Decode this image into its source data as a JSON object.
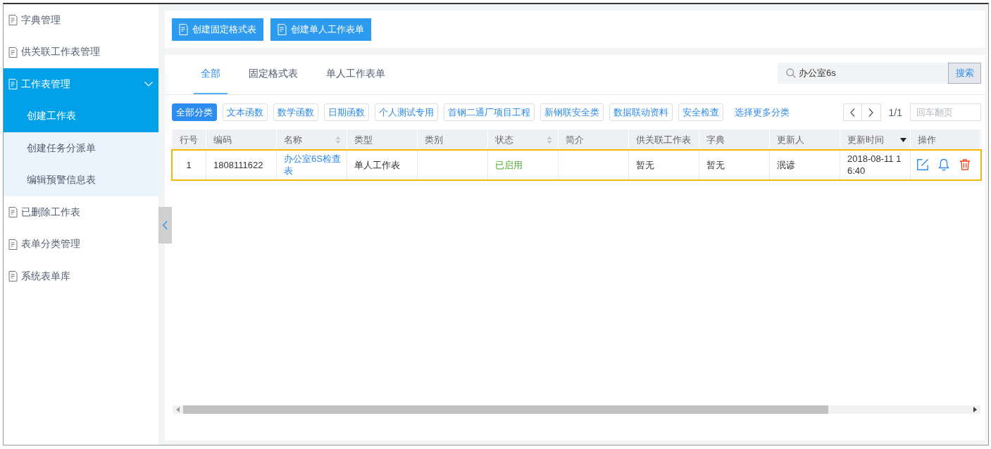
{
  "sidebar": {
    "items": [
      {
        "label": "字典管理",
        "selected": false
      },
      {
        "label": "供关联工作表管理",
        "selected": false
      },
      {
        "label": "工作表管理",
        "selected": true,
        "expanded": true,
        "children": [
          {
            "label": "创建工作表",
            "selected": true
          },
          {
            "label": "创建任务分派单",
            "selected": false
          },
          {
            "label": "编辑预警信息表",
            "selected": false
          }
        ]
      },
      {
        "label": "已删除工作表",
        "selected": false
      },
      {
        "label": "表单分类管理",
        "selected": false
      },
      {
        "label": "系统表单库",
        "selected": false
      }
    ]
  },
  "toolbar": {
    "buttons": [
      "创建固定格式表",
      "创建单人工作表单"
    ]
  },
  "tabs": [
    {
      "label": "全部",
      "selected": true
    },
    {
      "label": "固定格式表",
      "selected": false
    },
    {
      "label": "单人工作表单",
      "selected": false
    }
  ],
  "search": {
    "value": "办公室6s",
    "button": "搜索"
  },
  "categories": {
    "chips": [
      {
        "label": "全部分类",
        "selected": true
      },
      {
        "label": "文本函数",
        "selected": false
      },
      {
        "label": "数学函数",
        "selected": false
      },
      {
        "label": "日期函数",
        "selected": false
      },
      {
        "label": "个人测试专用",
        "selected": false
      },
      {
        "label": "首钢二通厂项目工程",
        "selected": false
      },
      {
        "label": "新钢联安全类",
        "selected": false
      },
      {
        "label": "数据联动资料",
        "selected": false
      },
      {
        "label": "安全检查",
        "selected": false
      }
    ],
    "more_link": "选择更多分类"
  },
  "pagination": {
    "page": "1/1",
    "jump_placeholder": "回车翻页"
  },
  "table": {
    "columns": [
      {
        "label": "行号",
        "sort_arrows": false,
        "sorted_descending": false
      },
      {
        "label": "编码",
        "sort_arrows": false,
        "sorted_descending": false
      },
      {
        "label": "名称",
        "sort_arrows": true,
        "sorted_descending": false
      },
      {
        "label": "类型",
        "sort_arrows": false,
        "sorted_descending": false
      },
      {
        "label": "类别",
        "sort_arrows": false,
        "sorted_descending": false
      },
      {
        "label": "状态",
        "sort_arrows": true,
        "sorted_descending": false
      },
      {
        "label": "简介",
        "sort_arrows": false,
        "sorted_descending": false
      },
      {
        "label": "供关联工作表",
        "sort_arrows": false,
        "sorted_descending": false
      },
      {
        "label": "字典",
        "sort_arrows": false,
        "sorted_descending": false
      },
      {
        "label": "更新人",
        "sort_arrows": false,
        "sorted_descending": false
      },
      {
        "label": "更新时间",
        "sort_arrows": false,
        "sorted_descending": true
      },
      {
        "label": "操作",
        "sort_arrows": false,
        "sorted_descending": false
      }
    ],
    "rows": [
      {
        "selected": true,
        "cells": [
          {
            "kind": "text",
            "text": "1"
          },
          {
            "kind": "text",
            "text": "1808111622"
          },
          {
            "kind": "link",
            "text": "办公室6S检查表"
          },
          {
            "kind": "text",
            "text": "单人工作表"
          },
          {
            "kind": "blank"
          },
          {
            "kind": "status",
            "text": "已启用",
            "enabled": true
          },
          {
            "kind": "blank"
          },
          {
            "kind": "text",
            "text": "暂无"
          },
          {
            "kind": "text",
            "text": "暂无"
          },
          {
            "kind": "text",
            "text": "泯谚"
          },
          {
            "kind": "text",
            "text": "2018-08-11 16:40"
          },
          {
            "kind": "actions"
          }
        ]
      }
    ]
  }
}
